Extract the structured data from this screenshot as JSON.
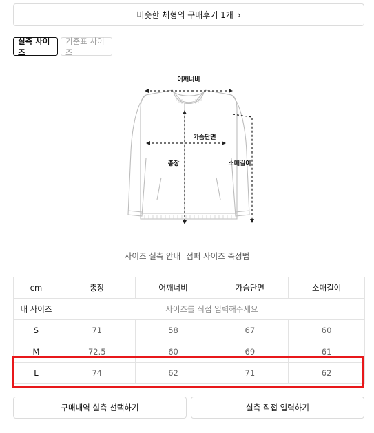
{
  "review_bar": {
    "label": "비슷한 체형의 구매후기 1개",
    "chevron": "›"
  },
  "tabs": [
    {
      "label": "실측 사이즈",
      "active": true
    },
    {
      "label": "기준표 사이즈",
      "active": false
    }
  ],
  "diagram": {
    "labels": {
      "shoulder": "어깨너비",
      "chest": "가슴단면",
      "length": "총장",
      "sleeve": "소매길이"
    }
  },
  "guide_links": [
    "사이즈 실측 안내",
    "점퍼 사이즈 측정법"
  ],
  "table": {
    "headers": [
      "cm",
      "총장",
      "어깨너비",
      "가슴단면",
      "소매길이"
    ],
    "my_size_label": "내 사이즈",
    "my_size_placeholder": "사이즈를 직접 입력해주세요",
    "rows": [
      {
        "size": "S",
        "values": [
          "71",
          "58",
          "67",
          "60"
        ]
      },
      {
        "size": "M",
        "values": [
          "72.5",
          "60",
          "69",
          "61"
        ]
      },
      {
        "size": "L",
        "values": [
          "74",
          "62",
          "71",
          "62"
        ]
      }
    ]
  },
  "buttons": {
    "purchase_history": "구매내역 실측 선택하기",
    "manual_input": "실측 직접 입력하기"
  },
  "colors": {
    "highlight": "#e8181b",
    "border": "#dcdcdc"
  }
}
